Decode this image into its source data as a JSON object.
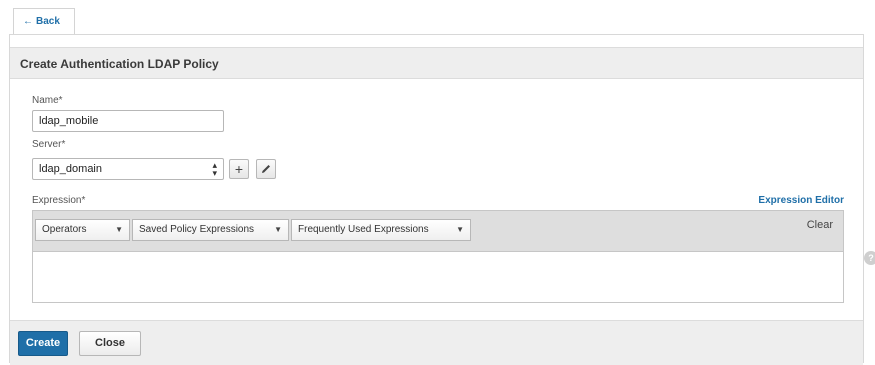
{
  "nav": {
    "back_label": "Back",
    "back_icon": "arrow-left-icon"
  },
  "form": {
    "title": "Create Authentication LDAP Policy",
    "name_label": "Name*",
    "name_value": "ldap_mobile",
    "server_label": "Server*",
    "server_value": "ldap_domain",
    "add_icon": "+",
    "expression_label": "Expression*",
    "expression_editor_link": "Expression Editor",
    "expression_value": ""
  },
  "expression_toolbar": {
    "operators": "Operators",
    "saved_policy_expressions": "Saved Policy Expressions",
    "frequently_used_expressions": "Frequently Used Expressions",
    "clear": "Clear"
  },
  "footer": {
    "create_label": "Create",
    "close_label": "Close"
  },
  "colors": {
    "accent": "#1f6fa8",
    "header_bg": "#eeeeee",
    "toolbar_bg": "#dedede"
  }
}
